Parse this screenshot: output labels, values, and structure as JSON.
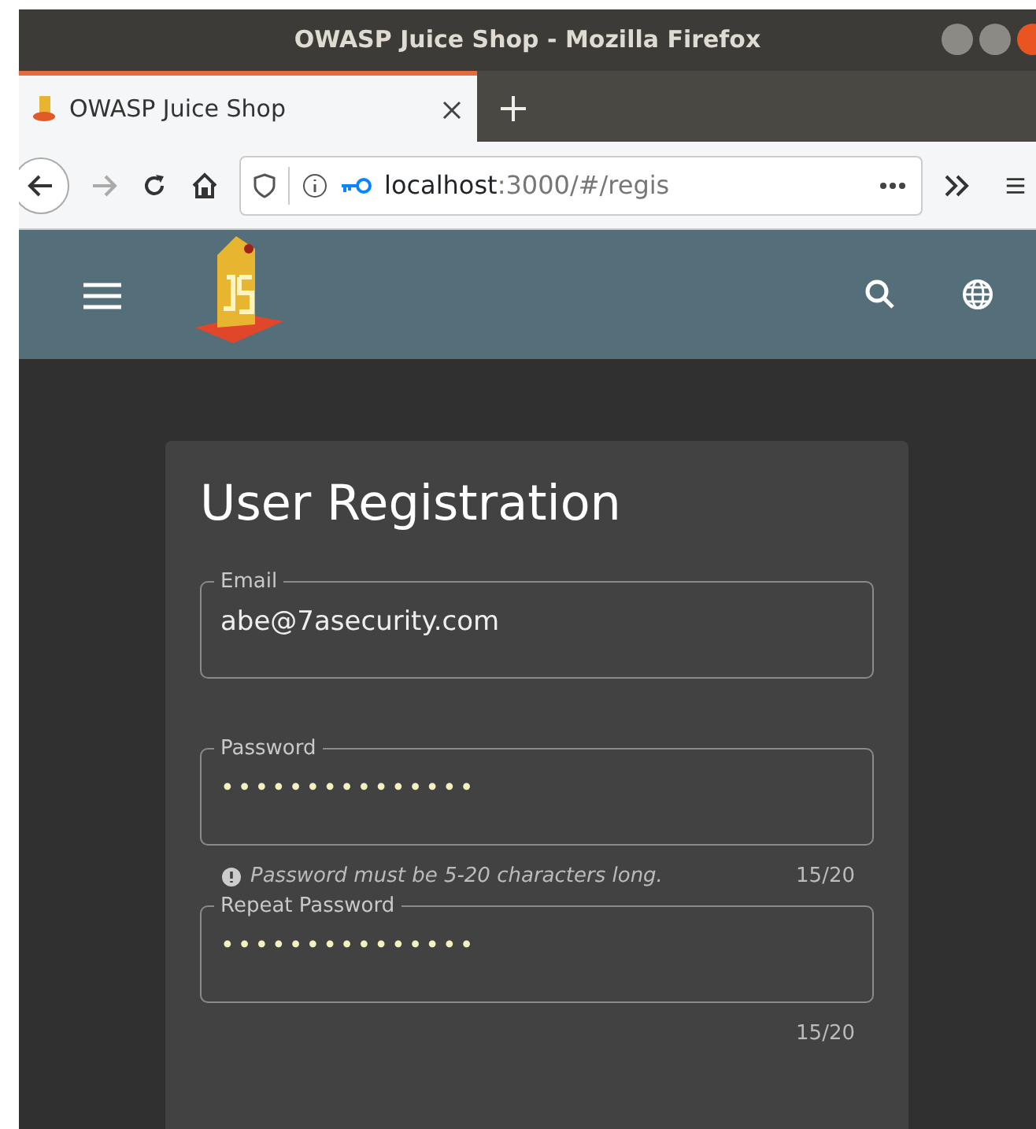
{
  "window": {
    "title": "OWASP Juice Shop - Mozilla Firefox"
  },
  "tabs": [
    {
      "label": "OWASP Juice Shop",
      "selected": true
    }
  ],
  "address_bar": {
    "host": "localhost",
    "path": ":3000/#/regis"
  },
  "form": {
    "title": "User Registration",
    "fields": [
      {
        "label": "Email",
        "value": "abe@7asecurity.com",
        "kind": "text"
      },
      {
        "label": "Password",
        "value": "•••••••••••••••",
        "kind": "password",
        "hint": "Password must be 5-20 characters long.",
        "counter": "15/20"
      },
      {
        "label": "Repeat Password",
        "value": "•••••••••••••••",
        "kind": "password",
        "counter": "15/20"
      }
    ]
  }
}
